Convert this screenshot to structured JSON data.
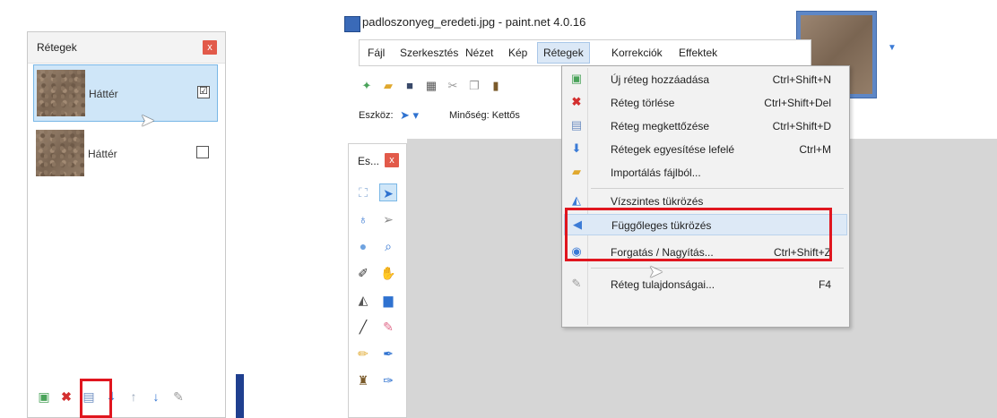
{
  "layers_panel": {
    "title": "Rétegek",
    "close": "x",
    "layers": [
      {
        "name": "Háttér",
        "checked": true,
        "check_glyph": "☑"
      },
      {
        "name": "Háttér",
        "checked": false,
        "check_glyph": ""
      }
    ],
    "toolbar_icons": [
      "add-layer-icon",
      "delete-layer-icon",
      "duplicate-layer-icon",
      "merge-down-icon",
      "move-up-icon",
      "move-down-icon",
      "properties-icon"
    ]
  },
  "app": {
    "title": "padloszonyeg_eredeti.jpg - paint.net 4.0.16",
    "menu": [
      "Fájl",
      "Szerkesztés",
      "Nézet",
      "Kép",
      "Rétegek",
      "Korrekciók",
      "Effektek"
    ],
    "active_menu": "Rétegek",
    "toolbar": {
      "eszkoz_label": "Eszköz:",
      "minoseg_label": "Minőség: Kettős"
    },
    "tools_window": {
      "title": "Es...",
      "close": "x"
    },
    "layers_menu": [
      {
        "label": "Új réteg hozzáadása",
        "shortcut": "Ctrl+Shift+N",
        "icon": "add-layer-icon"
      },
      {
        "label": "Réteg törlése",
        "shortcut": "Ctrl+Shift+Del",
        "icon": "delete-layer-icon"
      },
      {
        "label": "Réteg megkettőzése",
        "shortcut": "Ctrl+Shift+D",
        "icon": "duplicate-layer-icon"
      },
      {
        "label": "Rétegek egyesítése lefelé",
        "shortcut": "Ctrl+M",
        "icon": "merge-down-icon"
      },
      {
        "label": "Importálás fájlból...",
        "shortcut": "",
        "icon": "import-file-icon"
      },
      {
        "label": "Vízszintes tükrözés",
        "shortcut": "",
        "icon": "flip-horizontal-icon"
      },
      {
        "label": "Függőleges tükrözés",
        "shortcut": "",
        "icon": "flip-vertical-icon"
      },
      {
        "label": "Forgatás / Nagyítás...",
        "shortcut": "Ctrl+Shift+Z",
        "icon": "rotate-zoom-icon"
      },
      {
        "label": "Réteg tulajdonságai...",
        "shortcut": "F4",
        "icon": "layer-properties-icon"
      }
    ]
  },
  "colors": {
    "highlight_box": "#e0161f",
    "selection": "#cfe6f8",
    "accent": "#3a6ab8"
  }
}
